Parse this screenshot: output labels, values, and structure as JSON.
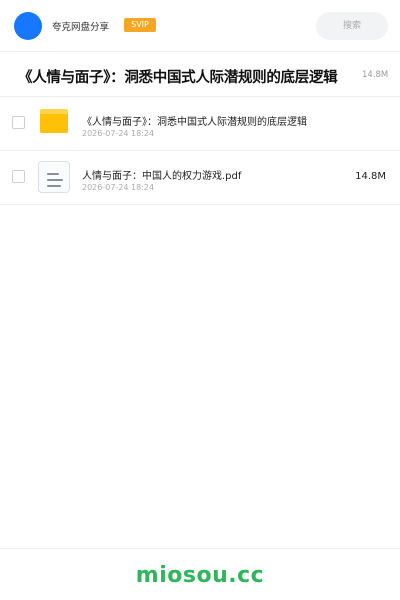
{
  "header": {
    "site_name": "夸克网盘分享",
    "badge": "SVIP",
    "search_placeholder": "搜索",
    "avatar_color": "#1677ff",
    "badge_color": "#f5a623"
  },
  "title_bar": {
    "title": "《人情与面子》：洞悉中国式人际潜规则的底层逻辑",
    "size": "14.8M"
  },
  "files": [
    {
      "type": "folder",
      "icon": "folder-icon",
      "name": "《人情与面子》：洞悉中国式人际潜规则的底层逻辑",
      "date": "2026-07-24 18:24",
      "size": ""
    },
    {
      "type": "file",
      "icon": "document-icon",
      "name": "人情与面子：中国人的权力游戏.pdf",
      "date": "2026-07-24 18:24",
      "size": "14.8M"
    }
  ],
  "footer": {
    "brand": "miosou.cc",
    "brand_color": "#2fb55b"
  }
}
